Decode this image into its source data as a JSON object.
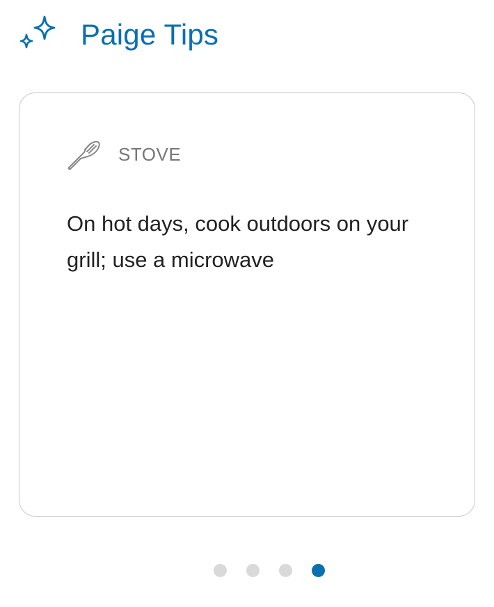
{
  "header": {
    "title": "Paige Tips",
    "icon": "sparkle-icon"
  },
  "card": {
    "category": {
      "icon": "spatula-icon",
      "label": "STOVE"
    },
    "tip": "On hot days, cook outdoors on your grill; use a microwave"
  },
  "pager": {
    "total": 4,
    "active_index": 3
  },
  "colors": {
    "accent": "#0a6fb0",
    "dot_inactive": "#d9d9d9",
    "card_border": "#c9c9c9",
    "category_text": "#777777",
    "body_text": "#222222"
  }
}
